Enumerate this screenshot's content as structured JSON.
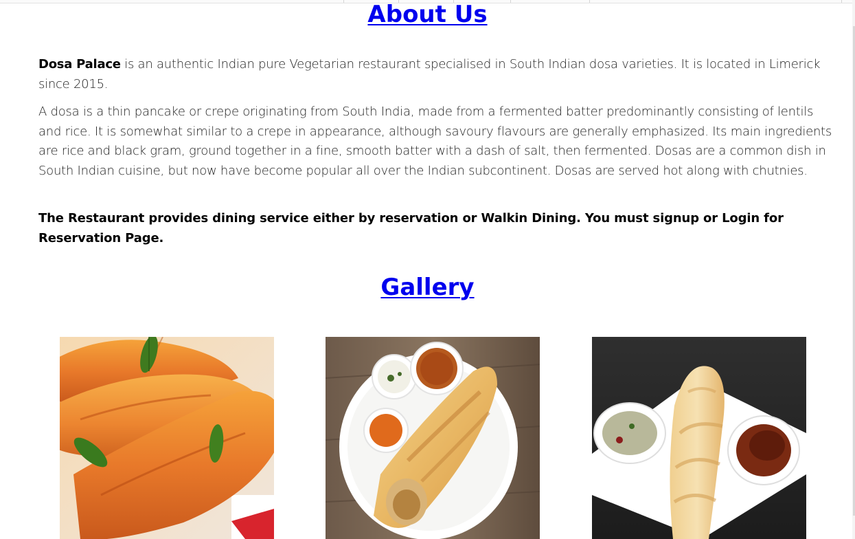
{
  "about": {
    "title": "About Us",
    "brand": "Dosa Palace",
    "intro_rest": " is an authentic Indian pure Vegetarian restaurant specialised in South Indian dosa varieties. It is located in Limerick since 2015.",
    "description": "A dosa is a thin pancake or crepe originating from South India, made from a fermented batter predominantly consisting of lentils and rice. It is somewhat similar to a crepe in appearance, although savoury flavours are generally emphasized. Its main ingredients are rice and black gram, ground together in a fine, smooth batter with a dash of salt, then fermented. Dosas are a common dish in South Indian cuisine, but now have become popular all over the Indian subcontinent. Dosas are served hot along with chutnies.",
    "notice": "The Restaurant provides dining service either by reservation or Walkin Dining. You must signup or Login for Reservation Page."
  },
  "gallery": {
    "title": "Gallery",
    "images": [
      {
        "icon": "crispy-dosa-rolls-photo"
      },
      {
        "icon": "dosa-with-chutney-and-sambar-photo"
      },
      {
        "icon": "paper-dosa-with-chutneys-photo"
      }
    ]
  },
  "colors": {
    "link": "#0000ee",
    "text": "#222222",
    "background": "#ffffff"
  }
}
